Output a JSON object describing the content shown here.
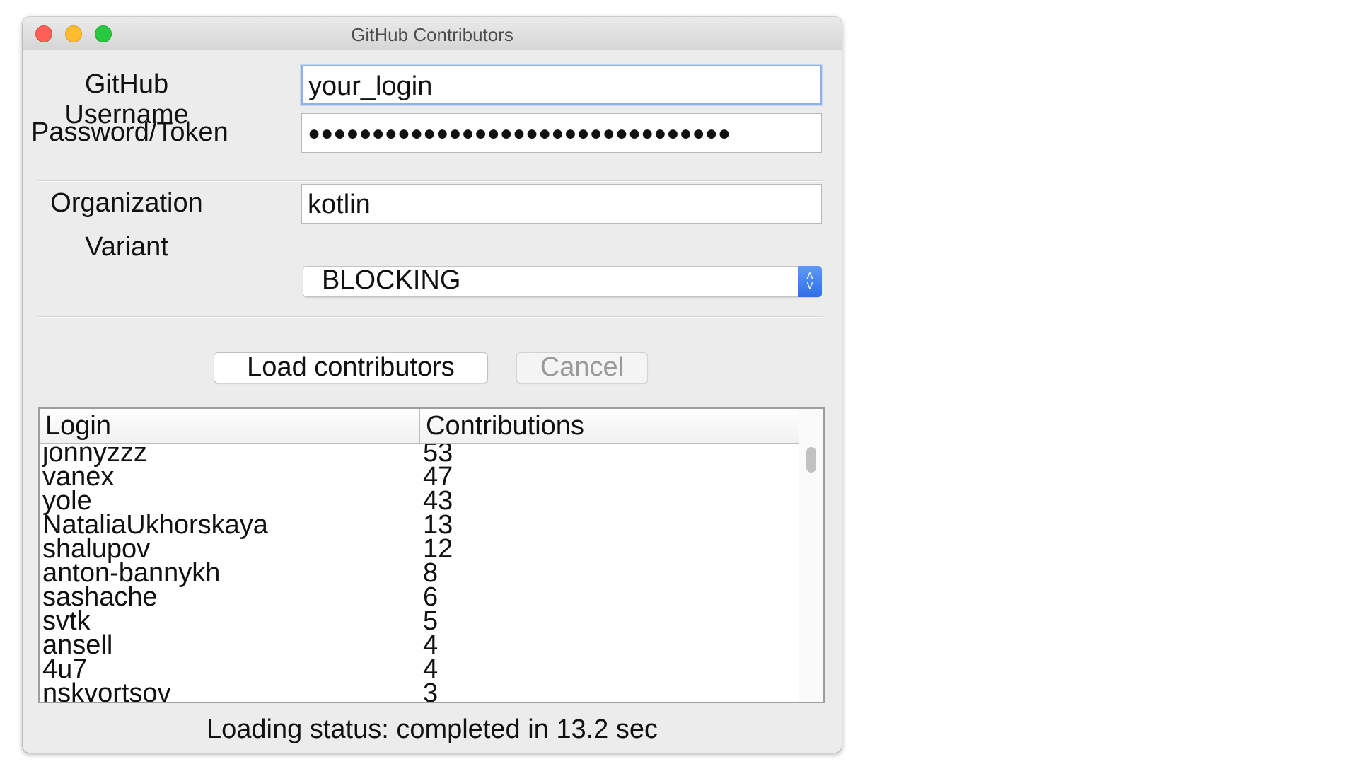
{
  "window": {
    "title": "GitHub Contributors"
  },
  "form": {
    "username_label": "GitHub Username",
    "username_value": "your_login",
    "password_label": "Password/Token",
    "password_value": "●●●●●●●●●●●●●●●●●●●●●●●●●●●●●●●●●",
    "organization_label": "Organization",
    "organization_value": "kotlin",
    "variant_label": "Variant",
    "variant_value": "BLOCKING"
  },
  "actions": {
    "load_label": "Load contributors",
    "cancel_label": "Cancel"
  },
  "table": {
    "columns": [
      "Login",
      "Contributions"
    ],
    "rows": [
      {
        "login": "jonnyzzz",
        "contributions": "53"
      },
      {
        "login": "vanex",
        "contributions": "47"
      },
      {
        "login": "yole",
        "contributions": "43"
      },
      {
        "login": "NataliaUkhorskaya",
        "contributions": "13"
      },
      {
        "login": "shalupov",
        "contributions": "12"
      },
      {
        "login": "anton-bannykh",
        "contributions": "8"
      },
      {
        "login": "sashache",
        "contributions": "6"
      },
      {
        "login": "svtk",
        "contributions": "5"
      },
      {
        "login": "ansell",
        "contributions": "4"
      },
      {
        "login": "4u7",
        "contributions": "4"
      },
      {
        "login": "nskvortsov",
        "contributions": "3"
      }
    ]
  },
  "status": {
    "text": "Loading status: completed in 13.2 sec"
  },
  "colors": {
    "close": "#fe5f57",
    "minimize": "#febc2e",
    "maximize": "#28c840",
    "select_accent": "#2f6fe6"
  }
}
